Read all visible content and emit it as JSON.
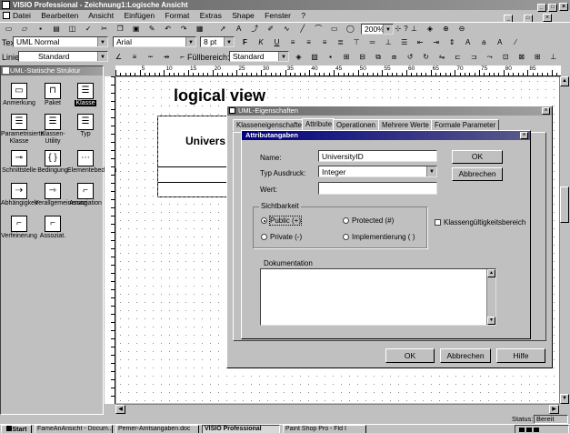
{
  "app": {
    "title": "VISIO Professional - Zeichnung1:Logische Ansicht",
    "window_controls": [
      "_",
      "□",
      "×"
    ]
  },
  "menu": [
    "Datei",
    "Bearbeiten",
    "Ansicht",
    "Einfügen",
    "Format",
    "Extras",
    "Shape",
    "Fenster",
    "?"
  ],
  "format_bar": {
    "style_label": "Text:",
    "style_value": "UML Normal",
    "font_value": "Arial",
    "size_value": "8 pt",
    "zoom_value": "200%"
  },
  "line_bar": {
    "style_label": "Linie:",
    "style_value": "Standard",
    "fill_label": "Füllbereich:",
    "fill_value": "Standard"
  },
  "stencil": {
    "title": "UML-Statische Struktur",
    "items": [
      "Anmerkung",
      "Paket",
      "Klasse",
      "Parametrisierte Klasse",
      "Klassen-Utility",
      "Typ",
      "Schnittstelle",
      "Bedingung",
      "Elementebedingung",
      "Abhängigkeit",
      "Verallgemeinerung",
      "Assoziation",
      "Verfeinerung",
      "Assoziat."
    ]
  },
  "canvas": {
    "heading": "logical view",
    "class_name_partial": "Univers"
  },
  "dialog": {
    "title": "UML-Eigenschaften",
    "close_glyph": "×",
    "tabs": [
      "Klasseneigenschaften",
      "Attribute",
      "Operationen",
      "Mehrere Werte",
      "Formale Parameter"
    ],
    "active_tab": "Attribute",
    "ok_label": "OK",
    "cancel_label": "Abbrechen",
    "help_label": "Hilfe"
  },
  "subdialog": {
    "title": "Attributangaben",
    "close_glyph": "×",
    "name_label": "Name:",
    "name_value": "UniversityID",
    "type_label": "Typ Ausdruck:",
    "type_value": "Integer",
    "value_label": "Wert:",
    "value_value": "",
    "visibility_label": "Sichtbarkeit",
    "radios": [
      {
        "label": "Public (+)",
        "checked": true
      },
      {
        "label": "Protected (#)",
        "checked": false
      },
      {
        "label": "Private (-)",
        "checked": false
      },
      {
        "label": "Implementierung ( )",
        "checked": false
      }
    ],
    "class_scope_label": "Klassengültigkeitsbereich",
    "doc_label": "Dokumentation",
    "ok_label": "OK",
    "cancel_label": "Abbrechen"
  },
  "status": {
    "label": "Status:",
    "value": "Bereit"
  },
  "taskbar": {
    "start": "Start",
    "tasks": [
      "FameAnAnsicht - Docum...",
      "Pemer-Amtsangaben.doc",
      "VISIO Professional",
      "Paint Shop Pro - Fld I"
    ]
  },
  "ruler_numbers": [
    "5",
    "10",
    "15",
    "20",
    "25",
    "30",
    "35",
    "40",
    "45",
    "50",
    "55",
    "60",
    "65",
    "70",
    "75",
    "80",
    "85"
  ],
  "colors": {
    "title_active": "#000080",
    "face": "#c0c0c0"
  }
}
